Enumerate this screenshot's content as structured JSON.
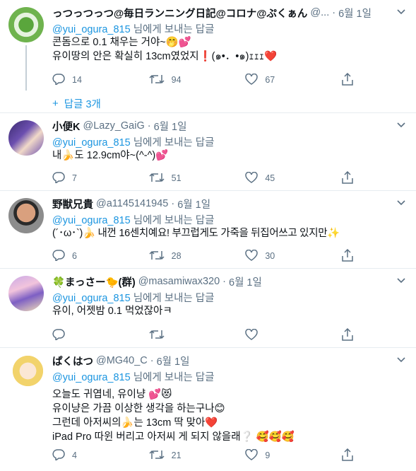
{
  "mention_prefix": "@yui_ogura_815",
  "mention_suffix": " 님에게 보내는 답글",
  "tweets": [
    {
      "name": "っつっつっつ@毎日ランニング日記@コロナ@ぷくぁん",
      "handle": "@...",
      "date": "6월 1일",
      "lines": [
        "콘돔으로 0.1 채우는 거야~🤭💕",
        "유이땅의 안은 확실히 13cm였었지❗(๑•．•๑)ｪｪｪ❤️"
      ],
      "replies": "14",
      "retweets": "94",
      "likes": "67"
    },
    {
      "name": "小便K",
      "handle": "@Lazy_GaiG",
      "date": "6월 1일",
      "lines": [
        "내🍌도 12.9cm야~(^-^)💕"
      ],
      "replies": "7",
      "retweets": "51",
      "likes": "45"
    },
    {
      "name": "野獣兄貴",
      "handle": "@a1145141945",
      "date": "6월 1일",
      "lines": [
        "(´･ω･`)🍌 내껀 16센치예요! 부끄럽게도 가죽을 뒤집어쓰고 있지만✨"
      ],
      "replies": "6",
      "retweets": "28",
      "likes": "30"
    },
    {
      "name": "🍀まっさー🐤(群)",
      "handle": "@masamiwax320",
      "date": "6월 1일",
      "lines": [
        "유이, 어젯밤 0.1 먹었잖아ㅋ"
      ],
      "replies": "",
      "retweets": "",
      "likes": ""
    },
    {
      "name": "ぱくはつ",
      "handle": "@MG40_C",
      "date": "6월 1일",
      "lines": [
        "오늘도 귀엽네, 유이냥 💕😻",
        "유이냥은 가끔 이상한 생각을 하는구나😊",
        "그런데 아저씨의🍌는 13cm 딱 맞아❤️",
        "iPad Pro 따윈 버리고 아저씨 게 되지 않을래❔ 🥰🥰🥰"
      ],
      "replies": "4",
      "retweets": "21",
      "likes": "9"
    }
  ],
  "show_replies_label": "답글 3개",
  "colors": {
    "link": "#1b95e0",
    "muted": "#5b7083",
    "heart": "#e0245e"
  },
  "icons": {
    "reply": "reply-icon",
    "retweet": "retweet-icon",
    "like": "heart-icon",
    "share": "share-icon",
    "more": "chevron-down-icon"
  }
}
